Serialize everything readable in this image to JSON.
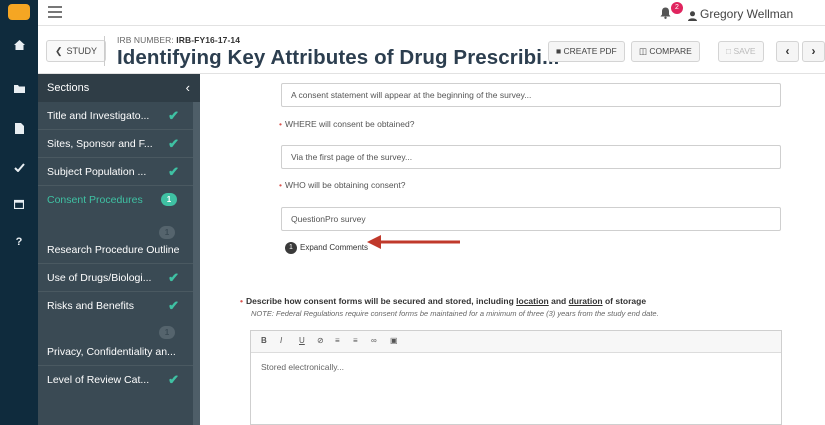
{
  "topbar": {
    "notification_count": "2",
    "user_name": "Gregory Wellman"
  },
  "header": {
    "back_label": "STUDY",
    "irb_prefix": "IRB NUMBER:",
    "irb_number": "IRB-FY16-17-14",
    "title": "Identifying Key Attributes of Drug Prescribi...",
    "create_pdf_label": "CREATE PDF",
    "compare_label": "COMPARE",
    "save_label": "SAVE"
  },
  "sidebar": {
    "header": "Sections",
    "items": [
      {
        "label": "Title and Investigato...",
        "state": "complete"
      },
      {
        "label": "Sites, Sponsor and F...",
        "state": "complete"
      },
      {
        "label": "Subject Population ...",
        "state": "complete"
      },
      {
        "label": "Consent Procedures",
        "state": "active",
        "comments": "1"
      },
      {
        "label": "Research Procedure Outline",
        "state": "comment",
        "comments": "1"
      },
      {
        "label": "Use of Drugs/Biologi...",
        "state": "complete"
      },
      {
        "label": "Risks and Benefits",
        "state": "complete"
      },
      {
        "label": "Privacy, Confidentiality an...",
        "state": "comment",
        "comments": "1"
      },
      {
        "label": "Level of Review Cat...",
        "state": "complete"
      }
    ]
  },
  "main": {
    "field1_value": "A consent statement will appear at the beginning of the survey...",
    "q_where": "WHERE will consent be obtained?",
    "field2_value": "Via the first page of the survey...",
    "q_who": "WHO will be obtaining consent?",
    "field3_value": "QuestionPro survey",
    "expand_count": "1",
    "expand_label": "Expand Comments",
    "desc_part1": "Describe how consent forms will be secured and stored, including ",
    "desc_location": "location",
    "desc_and": " and ",
    "desc_duration": "duration",
    "desc_part2": " of storage",
    "note": "NOTE: Federal Regulations require consent forms be maintained for a minimum of three (3) years from the study end date.",
    "editor_text": "Stored electronically..."
  },
  "colors": {
    "rail": "#0f2b3d",
    "sidebar": "#3a4a54",
    "accent": "#3fc1a3",
    "arrow": "#c0392b",
    "required": "#d9534f"
  }
}
